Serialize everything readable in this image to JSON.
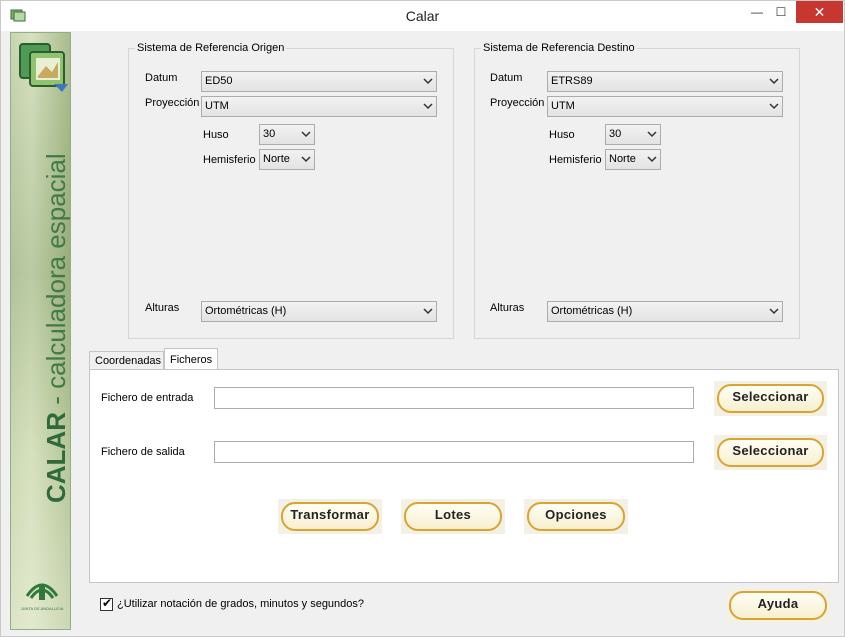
{
  "window": {
    "title": "Calar",
    "minimize": "—",
    "maximize": "☐",
    "close": "✕"
  },
  "sidebar": {
    "vertical_title_bold": "CALAR",
    "vertical_title_light": " - calculadora espacial",
    "junta_text": "JUNTA DE ANDALUCIA"
  },
  "origin": {
    "legend": "Sistema de Referencia Origen",
    "datum_label": "Datum",
    "datum_value": "ED50",
    "projection_label": "Proyección",
    "projection_value": "UTM",
    "huso_label": "Huso",
    "huso_value": "30",
    "hemisphere_label": "Hemisferio",
    "hemisphere_value": "Norte",
    "heights_label": "Alturas",
    "heights_value": "Ortométricas (H)"
  },
  "destination": {
    "legend": "Sistema de Referencia Destino",
    "datum_label": "Datum",
    "datum_value": "ETRS89",
    "projection_label": "Proyección",
    "projection_value": "UTM",
    "huso_label": "Huso",
    "huso_value": "30",
    "hemisphere_label": "Hemisferio",
    "hemisphere_value": "Norte",
    "heights_label": "Alturas",
    "heights_value": "Ortométricas (H)"
  },
  "tabs": [
    {
      "label": "Coordenadas",
      "active": false
    },
    {
      "label": "Ficheros",
      "active": true
    }
  ],
  "files": {
    "input_label": "Fichero de entrada",
    "input_value": "",
    "output_label": "Fichero de salida",
    "output_value": "",
    "select_label": "Seleccionar"
  },
  "actions": {
    "transform": "Transformar",
    "batch": "Lotes",
    "options": "Opciones",
    "help": "Ayuda"
  },
  "footer": {
    "dms_label": "¿Utilizar notación de grados, minutos y segundos?",
    "dms_checked": true
  },
  "colors": {
    "button_border": "#d9a530",
    "close_bg": "#c7372f",
    "sidebar_text": "#2f6a3a"
  }
}
